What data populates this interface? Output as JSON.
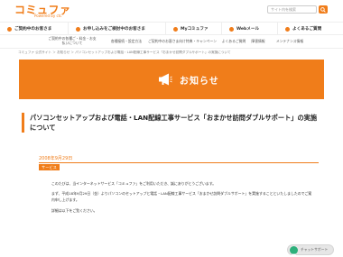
{
  "header": {
    "logo": "コミュファ",
    "logo_sub": "Powered by ctc",
    "search_placeholder": "サイト内を検索"
  },
  "main_nav": [
    {
      "label": "ご契約中のお客さま"
    },
    {
      "label": "お申し込みをご検討中のお客さま"
    },
    {
      "label": "Myコミュファ"
    },
    {
      "label": "Webメール"
    },
    {
      "label": "よくあるご質問"
    }
  ],
  "sub_nav": [
    {
      "line1": "ご契約中の各種ご・料金・お支",
      "line2": "払いについて"
    },
    {
      "line1": "各種接続・設定方法",
      "line2": ""
    },
    {
      "line1": "ご契約中のお客さま向け特典・キャンペーン",
      "line2": ""
    },
    {
      "line1": "よくあるご質問",
      "line2": ""
    },
    {
      "line1": "障害情報",
      "line2": ""
    },
    {
      "line1": "メンテナンス情報",
      "line2": ""
    }
  ],
  "breadcrumb": "コミュファ 公式サイト ＞ お知らせ ＞ パソコンセットアップおよび電話・LAN配線工事サービス「おまかせ訪問ダブルサポート」の実施について",
  "banner": {
    "title": "お知らせ",
    "icon": "megaphone-icon",
    "color": "#f07d1a"
  },
  "article": {
    "title": "パソコンセットアップおよび電話・LAN配線工事サービス「おまかせ訪問ダブルサポート」の実施について",
    "date": "2008年9月29日",
    "category": "サービス",
    "paragraphs": [
      "このたびは、当インターネットサービス「コミュファ」をご利用いただき、誠にありがとうございます。",
      "まず、平成18年9月29日（金）よりパソコンのセットアップと電話・LAN配線工事サービス「おまかせ訪問ダブルサポート」を実施することといたしましたのでご案内申し上げます。",
      "詳細は以下をご覧ください。"
    ]
  },
  "chat": {
    "label": "チャットサポート",
    "color": "#2db07b"
  }
}
